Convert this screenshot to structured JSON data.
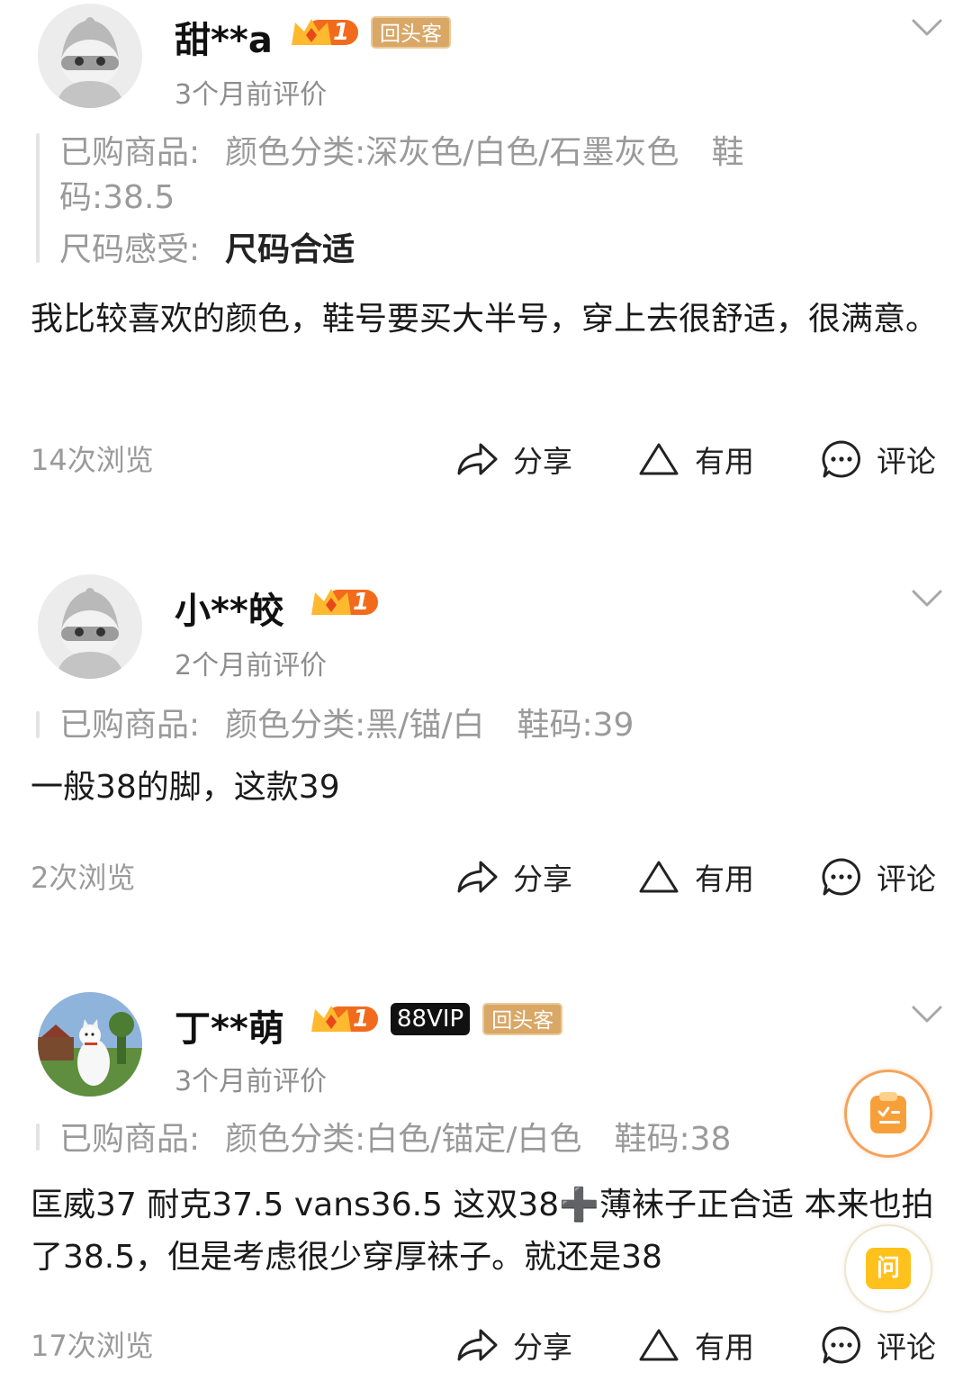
{
  "colors": {
    "accent_orange": "#f07a2a",
    "gold_tag": "#d9a766",
    "gray_text": "#9a9a9a",
    "size_highlight": "#ffd9c8"
  },
  "reviews": [
    {
      "username": "甜**a",
      "level": "1",
      "tags": [
        "回头客"
      ],
      "time": "3个月前评价",
      "purchased_label": "已购商品:",
      "purchased_line1": "颜色分类:深灰色/白色/石墨灰色　鞋",
      "purchased_line2": "码:38.5",
      "size_label": "尺码感受:",
      "size_value": "尺码合适",
      "content": "我比较喜欢的颜色，鞋号要买大半号，穿上去很舒适，很满意。",
      "views": "14次浏览",
      "avatar": "default-avatar"
    },
    {
      "username": "小**皎",
      "level": "1",
      "tags": [],
      "time": "2个月前评价",
      "purchased_label": "已购商品:",
      "purchased_line1": "颜色分类:黑/锚/白　鞋码:39",
      "content": "一般38的脚，这款39",
      "views": "2次浏览",
      "avatar": "default-avatar"
    },
    {
      "username": "丁**萌",
      "level": "1",
      "tags": [
        "88VIP",
        "回头客"
      ],
      "time": "3个月前评价",
      "purchased_label": "已购商品:",
      "purchased_line1": "颜色分类:白色/锚定/白色　鞋码:38",
      "content": "匡威37 耐克37.5 vans36.5  这双38➕薄袜子正合适 本来也拍了38.5，但是考虑很少穿厚袜子。就还是38",
      "views": "17次浏览",
      "avatar": "dog-photo-avatar"
    }
  ],
  "actions": {
    "share": "分享",
    "useful": "有用",
    "comment": "评论"
  },
  "float": {
    "ask_label": "问",
    "notes_icon": "notes-icon"
  }
}
